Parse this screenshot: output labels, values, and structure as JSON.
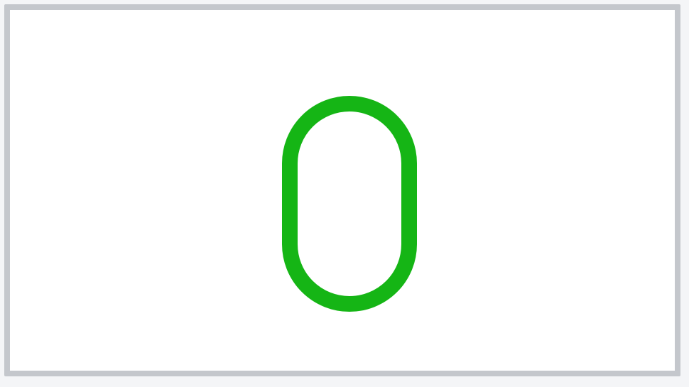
{
  "display": {
    "glyph_icon": "stadium-outline-icon",
    "glyph_color": "#15b515",
    "frame_border_color": "#c4c7cc"
  }
}
